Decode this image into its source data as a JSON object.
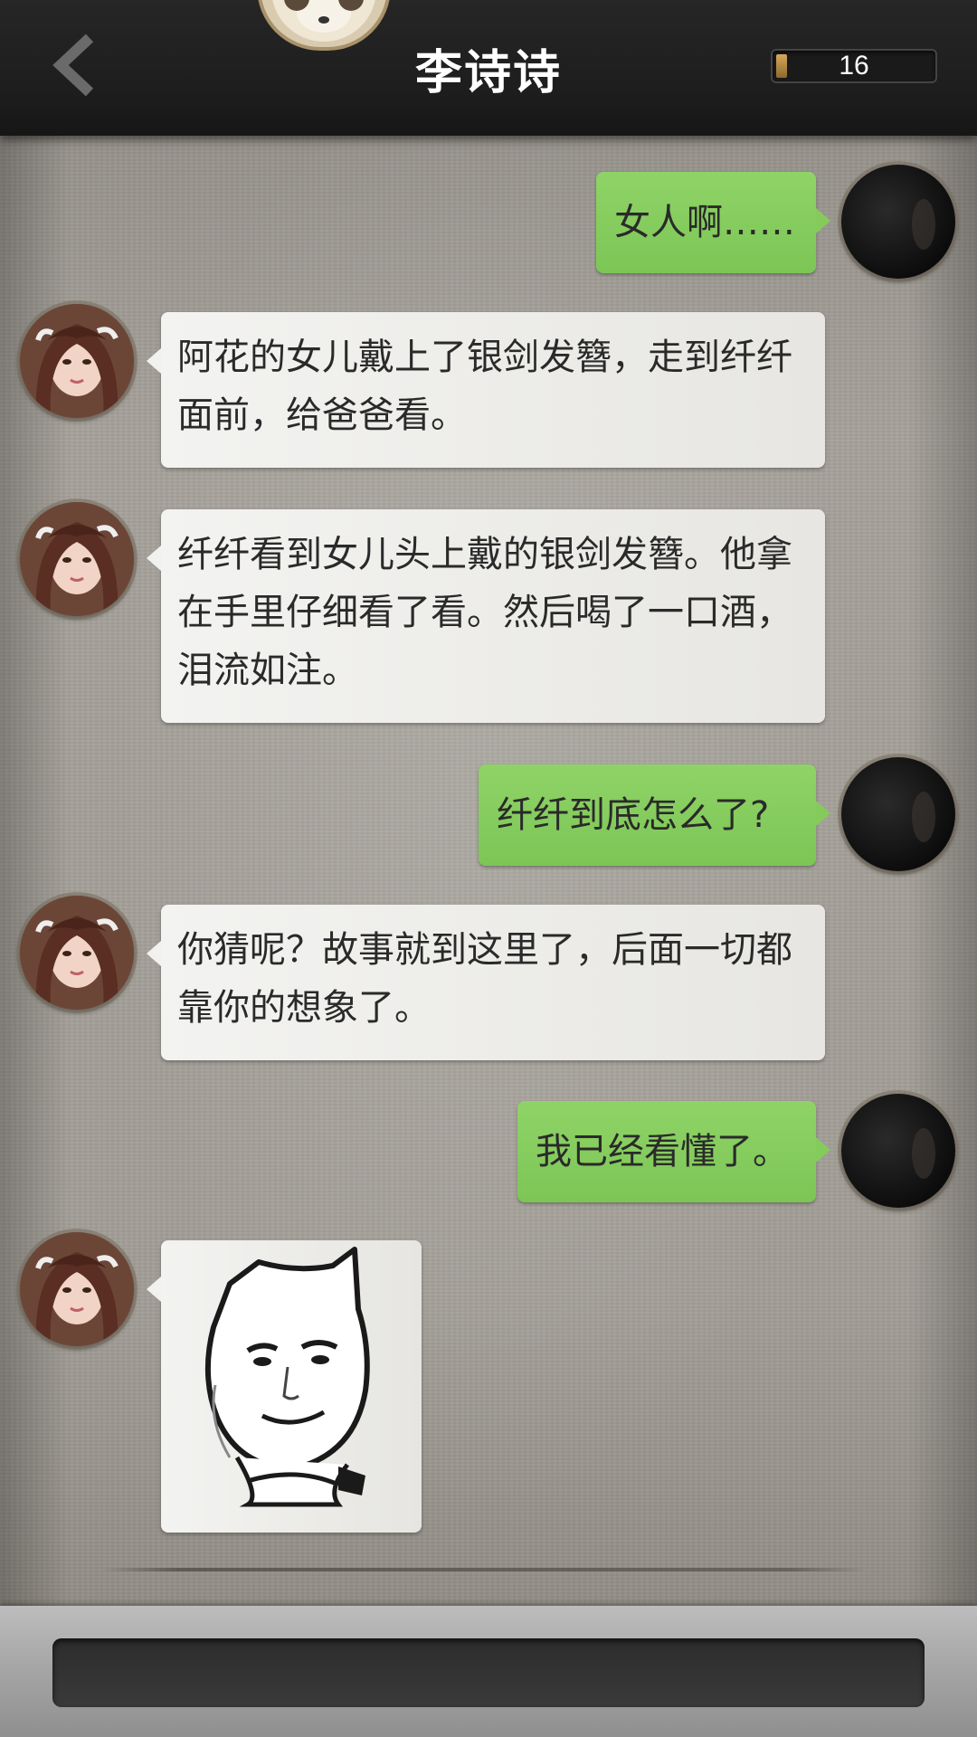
{
  "header": {
    "title": "李诗诗",
    "counter_value": "16",
    "counter_fill": 0.05
  },
  "messages": [
    {
      "side": "right",
      "text": "女人啊……"
    },
    {
      "side": "left",
      "text": "阿花的女儿戴上了银剑发簪，走到纤纤面前，给爸爸看。"
    },
    {
      "side": "left",
      "text": "纤纤看到女儿头上戴的银剑发簪。他拿在手里仔细看了看。然后喝了一口酒，泪流如注。"
    },
    {
      "side": "right",
      "text": "纤纤到底怎么了?"
    },
    {
      "side": "left",
      "text": "你猜呢？故事就到这里了，后面一切都靠你的想象了。"
    },
    {
      "side": "right",
      "text": "我已经看懂了。"
    },
    {
      "side": "left",
      "type": "sticker",
      "icon": "smug-cat-face-sticker"
    }
  ],
  "input": {
    "value": ""
  }
}
